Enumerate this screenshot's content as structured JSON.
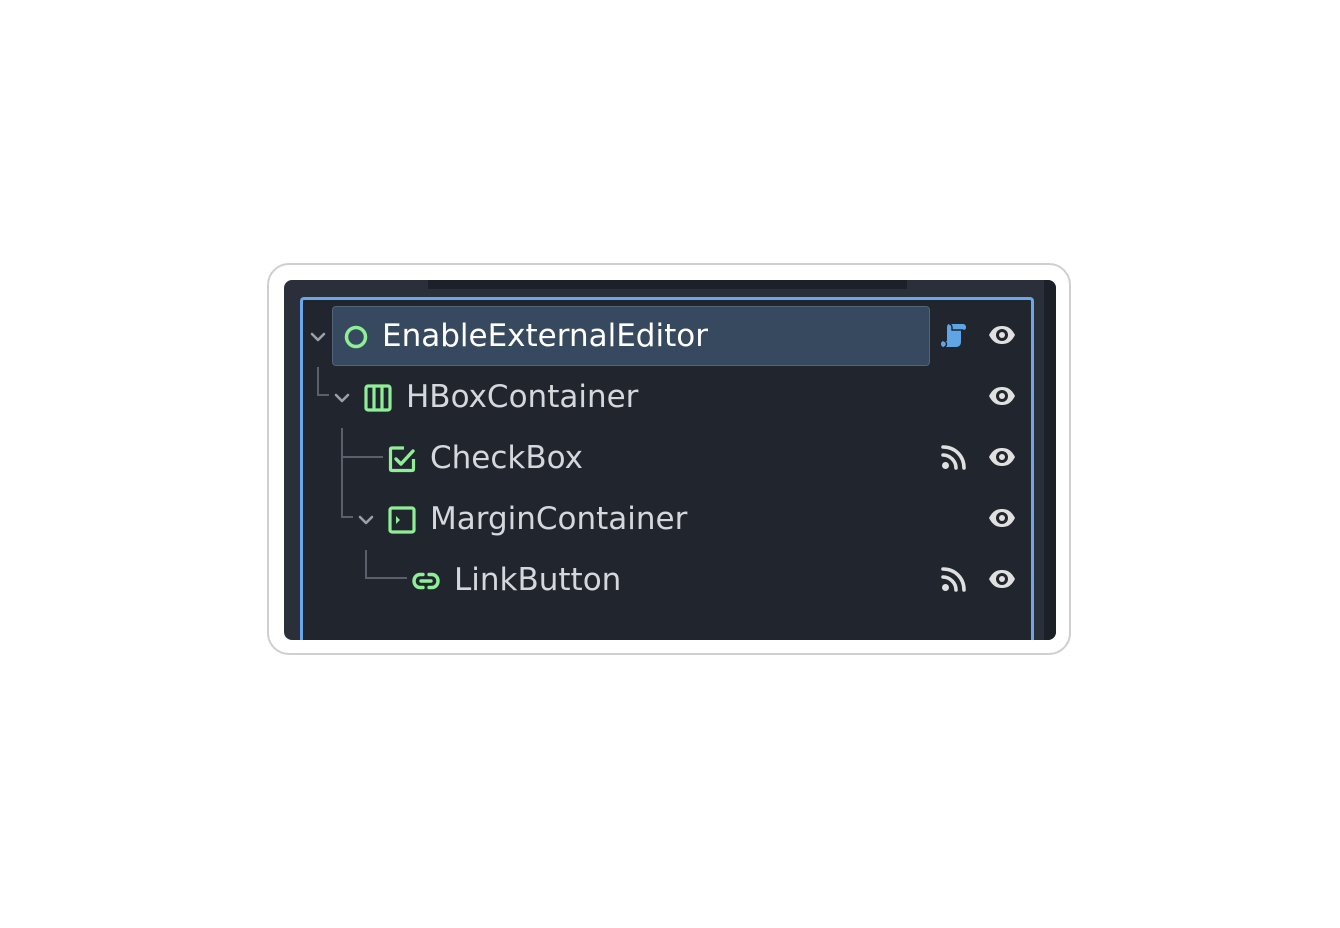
{
  "scene_tree": {
    "nodes": [
      {
        "name": "EnableExternalEditor",
        "type_icon": "circle-node-icon",
        "expanded": true,
        "selected": true,
        "has_script": true,
        "has_signals": false,
        "visible": true
      },
      {
        "name": "HBoxContainer",
        "type_icon": "hbox-container-icon",
        "expanded": true,
        "selected": false,
        "has_script": false,
        "has_signals": false,
        "visible": true
      },
      {
        "name": "CheckBox",
        "type_icon": "checkbox-icon",
        "expanded": false,
        "selected": false,
        "has_script": false,
        "has_signals": true,
        "visible": true
      },
      {
        "name": "MarginContainer",
        "type_icon": "margin-container-icon",
        "expanded": true,
        "selected": false,
        "has_script": false,
        "has_signals": false,
        "visible": true
      },
      {
        "name": "LinkButton",
        "type_icon": "link-button-icon",
        "expanded": false,
        "selected": false,
        "has_script": false,
        "has_signals": true,
        "visible": true
      }
    ]
  },
  "colors": {
    "node_icon_green": "#8eef97",
    "script_icon_blue": "#5fa5e6",
    "focus_border": "#6aa8ec",
    "selection_bg": "#36495e",
    "panel_bg": "#21252d",
    "eye_icon": "#e0e0e0"
  }
}
